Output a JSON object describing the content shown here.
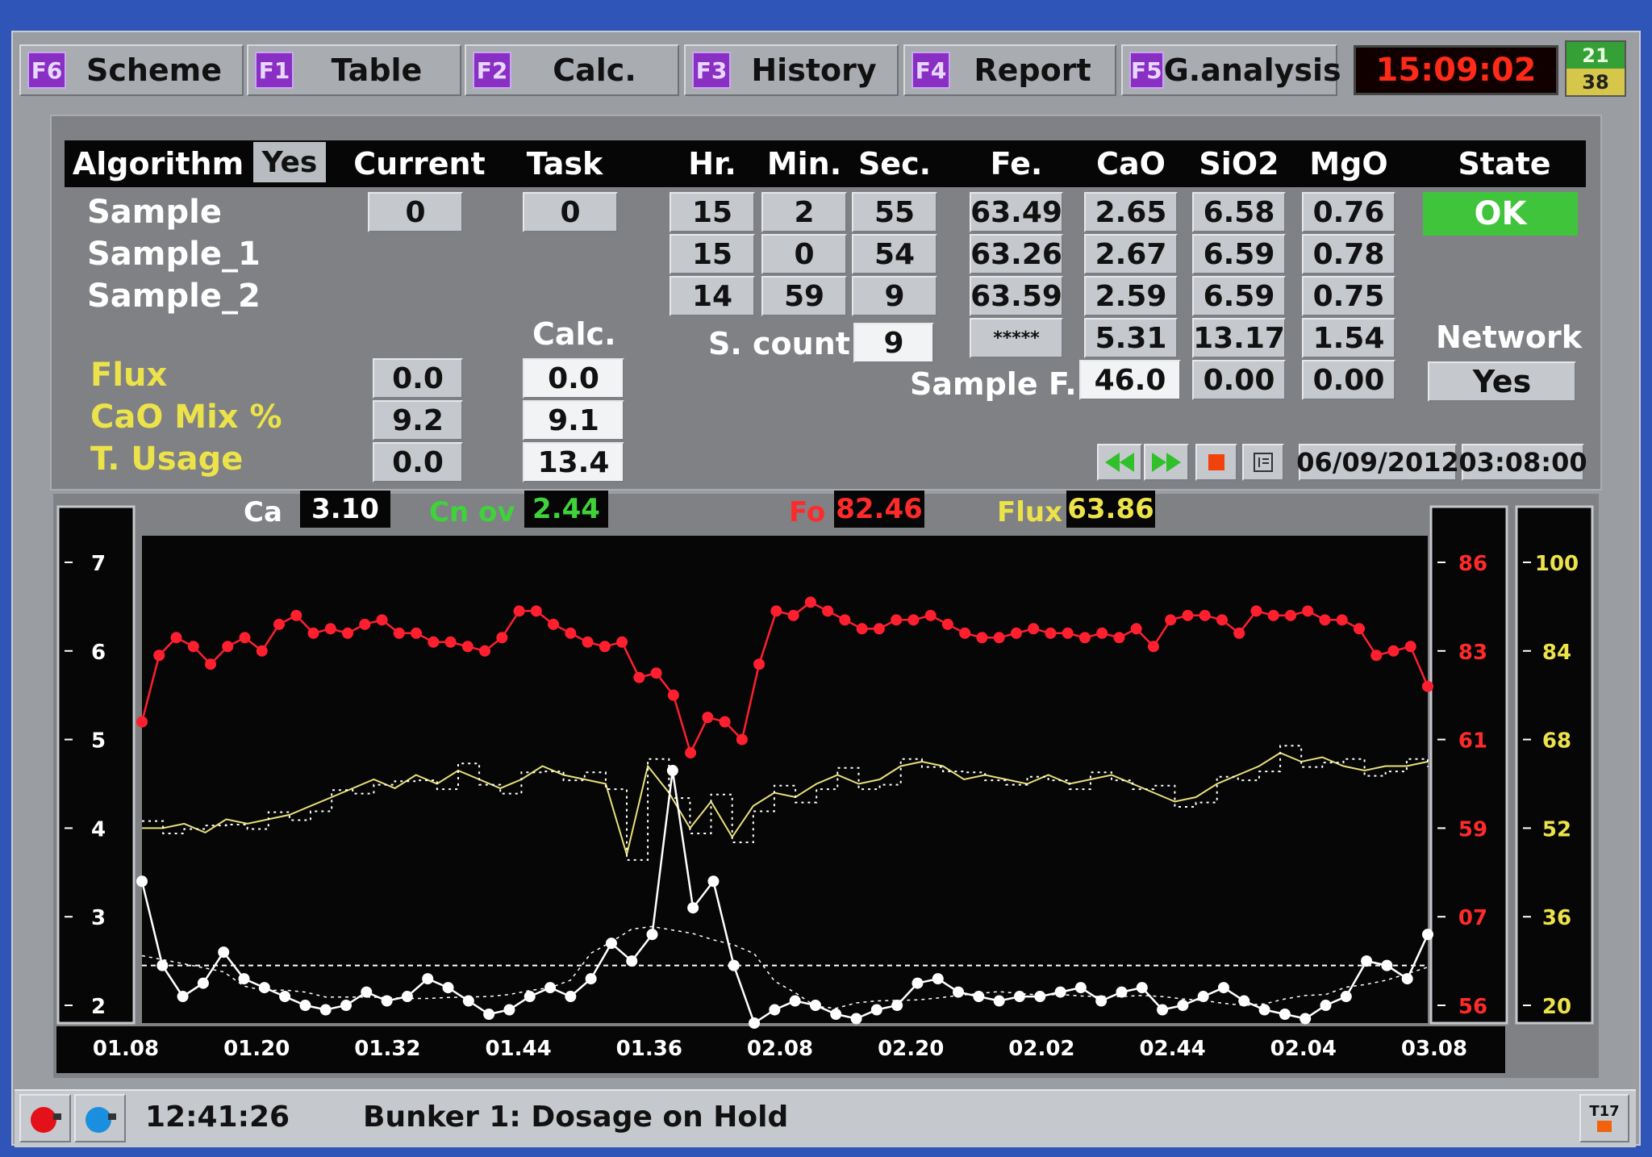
{
  "toolbar": {
    "tabs": [
      {
        "key": "F6",
        "label": "Scheme"
      },
      {
        "key": "F1",
        "label": "Table"
      },
      {
        "key": "F2",
        "label": "Calc."
      },
      {
        "key": "F3",
        "label": "History"
      },
      {
        "key": "F4",
        "label": "Report"
      },
      {
        "key": "F5",
        "label": "G.analysis"
      }
    ],
    "clock": "15:09:02",
    "badge_top": "21",
    "badge_bottom": "38"
  },
  "table": {
    "headers": {
      "algorithm": "Algorithm",
      "algorithm_toggle": "Yes",
      "current": "Current",
      "task": "Task",
      "hr": "Hr.",
      "min": "Min.",
      "sec": "Sec.",
      "fe": "Fe.",
      "cao": "CaO",
      "sio2": "SiO2",
      "mgo": "MgO",
      "state": "State"
    },
    "rows": [
      {
        "label": "Sample",
        "current": "0",
        "task": "0",
        "hr": "15",
        "min": "2",
        "sec": "55",
        "fe": "63.49",
        "cao": "2.65",
        "sio2": "6.58",
        "mgo": "0.76"
      },
      {
        "label": "Sample_1",
        "hr": "15",
        "min": "0",
        "sec": "54",
        "fe": "63.26",
        "cao": "2.67",
        "sio2": "6.59",
        "mgo": "0.78"
      },
      {
        "label": "Sample_2",
        "hr": "14",
        "min": "59",
        "sec": "9",
        "fe": "63.59",
        "cao": "2.59",
        "sio2": "6.59",
        "mgo": "0.75"
      }
    ],
    "state_value": "OK",
    "calc_label": "Calc.",
    "s_count_label": "S. count",
    "s_count_value": "9",
    "avg_row": {
      "fe": "*****",
      "cao": "5.31",
      "sio2": "13.17",
      "mgo": "1.54"
    },
    "sample_f_label": "Sample F.",
    "sample_f_row": {
      "fe": "46.0",
      "cao": "0.00",
      "sio2": "0.00",
      "mgo": "0.00"
    },
    "network_label": "Network",
    "network_value": "Yes",
    "params": [
      {
        "label": "Flux",
        "current": "0.0",
        "calc": "0.0"
      },
      {
        "label": "CaO Mix %",
        "current": "9.2",
        "calc": "9.1"
      },
      {
        "label": "T. Usage",
        "current": "0.0",
        "calc": "13.4"
      }
    ],
    "date": "06/09/2012",
    "time": "03:08:00"
  },
  "readouts": [
    {
      "label": "Ca",
      "value": "3.10",
      "color": "#ffffff"
    },
    {
      "label": "Cn ov",
      "value": "2.44",
      "color": "#3fd23a"
    },
    {
      "label": "Fo",
      "value": "82.46",
      "color": "#ff2a2a"
    },
    {
      "label": "Flux",
      "value": "63.86",
      "color": "#ece24a"
    }
  ],
  "status": {
    "time": "12:41:26",
    "message": "Bunker 1: Dosage on Hold",
    "corner": "T17"
  },
  "colors": {
    "fe_series": "#ff1f2f",
    "flux_series": "#e8e07a",
    "ca_series": "#ffffff",
    "ok": "#3fc43c",
    "fkey": "#8a2fc4"
  },
  "chart_data": {
    "type": "line",
    "x_ticks": [
      "01.08",
      "01.20",
      "01.32",
      "01.44",
      "01.36",
      "02.08",
      "02.20",
      "02.02",
      "02.44",
      "02.04",
      "03.08"
    ],
    "y_left": {
      "ticks": [
        "7",
        "6",
        "5",
        "4",
        "3",
        "2"
      ],
      "range": [
        1.8,
        7.3
      ]
    },
    "y_right_red": {
      "ticks": [
        "86",
        "83",
        "61",
        "59",
        "07",
        "56"
      ]
    },
    "y_right_yellow": {
      "ticks": [
        "100",
        "84",
        "68",
        "52",
        "36",
        "20"
      ]
    },
    "series": [
      {
        "name": "Fo",
        "color": "#ff1f2f",
        "values": [
          5.2,
          5.95,
          6.15,
          6.05,
          5.85,
          6.05,
          6.15,
          6.0,
          6.3,
          6.4,
          6.2,
          6.25,
          6.2,
          6.3,
          6.35,
          6.2,
          6.2,
          6.1,
          6.1,
          6.05,
          6.0,
          6.15,
          6.45,
          6.45,
          6.3,
          6.2,
          6.1,
          6.05,
          6.1,
          5.7,
          5.75,
          5.5,
          4.85,
          5.25,
          5.2,
          5.0,
          5.85,
          6.45,
          6.4,
          6.55,
          6.45,
          6.35,
          6.25,
          6.25,
          6.35,
          6.35,
          6.4,
          6.3,
          6.2,
          6.15,
          6.15,
          6.2,
          6.25,
          6.2,
          6.2,
          6.15,
          6.2,
          6.15,
          6.25,
          6.05,
          6.35,
          6.4,
          6.4,
          6.35,
          6.2,
          6.45,
          6.4,
          6.4,
          6.45,
          6.35,
          6.35,
          6.25,
          5.95,
          6.0,
          6.05,
          5.6
        ]
      },
      {
        "name": "Flux",
        "color": "#e8e07a",
        "values": [
          4.0,
          4.0,
          4.05,
          3.95,
          4.1,
          4.05,
          4.1,
          4.15,
          4.25,
          4.35,
          4.45,
          4.55,
          4.45,
          4.6,
          4.5,
          4.65,
          4.55,
          4.45,
          4.55,
          4.7,
          4.6,
          4.55,
          4.5,
          3.7,
          4.7,
          4.4,
          4.0,
          4.3,
          3.9,
          4.25,
          4.4,
          4.35,
          4.5,
          4.6,
          4.5,
          4.55,
          4.7,
          4.75,
          4.7,
          4.55,
          4.6,
          4.55,
          4.5,
          4.6,
          4.5,
          4.55,
          4.6,
          4.5,
          4.4,
          4.3,
          4.35,
          4.5,
          4.6,
          4.7,
          4.85,
          4.75,
          4.8,
          4.7,
          4.65,
          4.7,
          4.7,
          4.75
        ]
      },
      {
        "name": "Ca",
        "color": "#ffffff",
        "values": [
          3.4,
          2.45,
          2.1,
          2.25,
          2.6,
          2.3,
          2.2,
          2.1,
          2.0,
          1.95,
          2.0,
          2.15,
          2.05,
          2.1,
          2.3,
          2.2,
          2.05,
          1.9,
          1.95,
          2.1,
          2.2,
          2.1,
          2.3,
          2.7,
          2.5,
          2.8,
          4.65,
          3.1,
          3.4,
          2.45,
          1.75,
          1.95,
          2.05,
          2.0,
          1.9,
          1.85,
          1.95,
          2.0,
          2.25,
          2.3,
          2.15,
          2.1,
          2.05,
          2.1,
          2.1,
          2.15,
          2.2,
          2.05,
          2.15,
          2.2,
          1.95,
          2.0,
          2.1,
          2.2,
          2.05,
          1.95,
          1.9,
          1.85,
          2.0,
          2.1,
          2.5,
          2.45,
          2.3,
          2.8
        ]
      }
    ]
  }
}
